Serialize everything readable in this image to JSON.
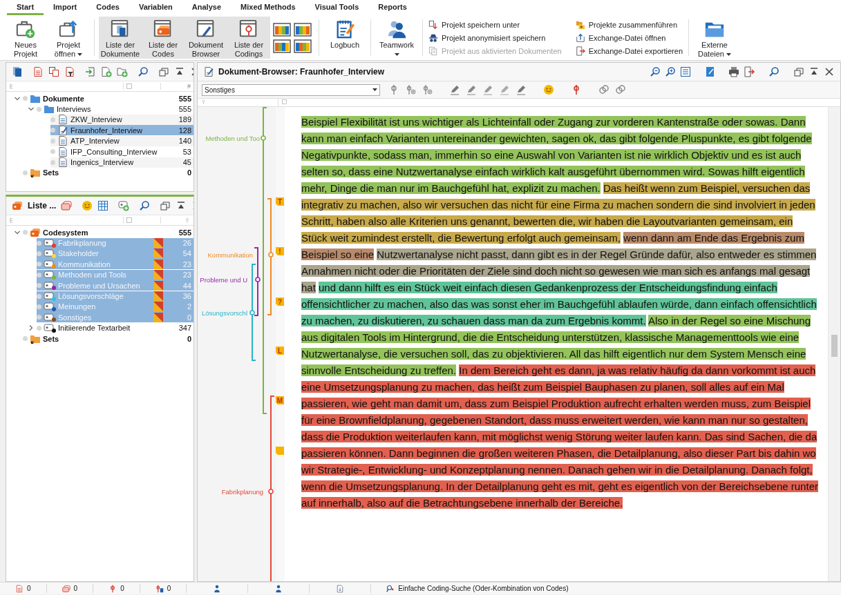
{
  "ribbon_tabs": [
    {
      "label": "Start",
      "selected": true
    },
    {
      "label": "Import",
      "selected": false
    },
    {
      "label": "Codes",
      "selected": false
    },
    {
      "label": "Variablen",
      "selected": false
    },
    {
      "label": "Analyse",
      "selected": false
    },
    {
      "label": "Mixed Methods",
      "selected": false
    },
    {
      "label": "Visual Tools",
      "selected": false
    },
    {
      "label": "Reports",
      "selected": false
    }
  ],
  "ribbon": [
    {
      "kind": "large",
      "label": "Neues Projekt",
      "dropdown": false,
      "selected": false
    },
    {
      "kind": "large",
      "label": "Projekt öffnen",
      "dropdown": true,
      "selected": false
    },
    {
      "kind": "large",
      "label": "Liste der Dokumente",
      "dropdown": false,
      "selected": true
    },
    {
      "kind": "large",
      "label": "Liste der Codes",
      "dropdown": false,
      "selected": true
    },
    {
      "kind": "large",
      "label": "Dokument Browser",
      "dropdown": false,
      "selected": true
    },
    {
      "kind": "large",
      "label": "Liste der Codings",
      "dropdown": false,
      "selected": true
    },
    {
      "kind": "layouts"
    },
    {
      "kind": "large",
      "label": "Logbuch",
      "dropdown": false,
      "selected": false
    },
    {
      "kind": "large",
      "label": "Teamwork",
      "dropdown": true,
      "selected": false
    },
    {
      "kind": "commands",
      "items": [
        {
          "label": "Projekt speichern unter",
          "disabled": false
        },
        {
          "label": "Projekt anonymisiert speichern",
          "disabled": false
        },
        {
          "label": "Projekt aus aktivierten Dokumenten",
          "disabled": true
        },
        {
          "label": "Projekte zusammenführen",
          "disabled": false
        },
        {
          "label": "Exchange-Datei öffnen",
          "disabled": false
        },
        {
          "label": "Exchange-Datei exportieren",
          "disabled": false
        }
      ]
    },
    {
      "kind": "large",
      "label": "Externe Dateien",
      "dropdown": true,
      "selected": false
    }
  ],
  "documents_panel": {
    "count_header": "#",
    "tree": [
      {
        "kind": "folder",
        "label": "Dokumente",
        "count": "555",
        "expanded": true,
        "children": [
          {
            "kind": "folder",
            "label": "Interviews",
            "count": "555",
            "expanded": true,
            "children": [
              {
                "kind": "document",
                "label": "ZKW_Interview",
                "count": "189",
                "selected": false,
                "open": false
              },
              {
                "kind": "document",
                "label": "Fraunhofer_Interview",
                "count": "128",
                "selected": true,
                "open": true
              },
              {
                "kind": "document",
                "label": "ATP_Interview",
                "count": "140",
                "selected": false,
                "open": false
              },
              {
                "kind": "document",
                "label": "IFP_Consulting_Interview",
                "count": "53",
                "selected": false,
                "open": false
              },
              {
                "kind": "document",
                "label": "Ingenics_Interview",
                "count": "45",
                "selected": false,
                "open": false
              }
            ]
          }
        ]
      },
      {
        "kind": "set",
        "label": "Sets",
        "count": "0"
      }
    ]
  },
  "codes_panel": {
    "title": "Liste ...",
    "tree": [
      {
        "kind": "codesystem",
        "label": "Codesystem",
        "count": "555",
        "expanded": true,
        "children": [
          {
            "kind": "code",
            "label": "Fabrikplanung",
            "count": "26",
            "color": "#e53935",
            "selected": true,
            "flag": true
          },
          {
            "kind": "code",
            "label": "Stakeholder",
            "count": "54",
            "color": "#fdd835",
            "selected": true,
            "flag": true
          },
          {
            "kind": "code",
            "label": "Kommunikation",
            "count": "23",
            "color": "#fb8c00",
            "selected": true,
            "flag": true
          },
          {
            "kind": "code",
            "label": "Methoden und Tools",
            "count": "23",
            "color": "#7cb342",
            "selected": true,
            "flag": true
          },
          {
            "kind": "code",
            "label": "Probleme und Ursachen",
            "count": "44",
            "color": "#8e24aa",
            "selected": true,
            "flag": true
          },
          {
            "kind": "code",
            "label": "Lösungsvorschläge",
            "count": "36",
            "color": "#26c6da",
            "selected": true,
            "flag": true
          },
          {
            "kind": "code",
            "label": "Meinungen",
            "count": "2",
            "color": "#1e5aa8",
            "selected": true,
            "flag": true
          },
          {
            "kind": "code",
            "label": "Sonstiges",
            "count": "0",
            "color": "#8d4a1a",
            "selected": true,
            "flag": true
          },
          {
            "kind": "code",
            "label": "Initiierende Textarbeit",
            "count": "347",
            "color": "#111111",
            "selected": false,
            "flag": false,
            "expanded": false
          }
        ]
      },
      {
        "kind": "set",
        "label": "Sets",
        "count": "0"
      }
    ]
  },
  "document_browser": {
    "title": "Dokument-Browser: Fraunhofer_Interview",
    "code_dropdown": "Sonstiges",
    "codings": [
      {
        "code": "Methoden und Too",
        "color": "#7cb342"
      },
      {
        "code": "Kommunikation",
        "color": "#f08a24"
      },
      {
        "code": "Probleme und U",
        "color": "#9c27b0"
      },
      {
        "code": "Lösungsvorschl",
        "color": "#26b5c9"
      },
      {
        "code": "Fabrikplanung",
        "color": "#e2493a"
      }
    ],
    "memos": [
      {
        "kind": "letter",
        "symbol": "T"
      },
      {
        "kind": "letter",
        "symbol": "!"
      },
      {
        "kind": "letter",
        "symbol": "?"
      },
      {
        "kind": "letter",
        "symbol": "L"
      },
      {
        "kind": "letter",
        "symbol": "M"
      },
      {
        "kind": "plain"
      }
    ],
    "segments": [
      {
        "color": "#93c35a",
        "text": "Beispiel Flexibilität ist uns wichtiger als Lichteinfall oder Zugang zur vorderen Kantenstraße oder sowas. Dann kann man einfach Varianten untereinander gewichten, sagen ok, das gibt folgende Pluspunkte, es gibt folgende Negativpunkte, sodass man, immerhin so eine Auswahl von Varianten ist nie wirklich Objektiv und es ist auch selten so, dass eine Nutzwertanalyse einfach wirklich kalt ausgeführt übernommen wird. Sowas hilft eigentlich mehr, Dinge die man nur im Bauchgefühl hat, explizit zu machen."
      },
      {
        "color": "#c8aa4c",
        "text": "Das heißt wenn zum Beispiel, versuchen das integrativ zu machen, also wir versuchen das nicht für eine Firma zu machen sondern die sind involviert in jeden Schritt, haben also alle Kriterien uns genannt, bewerten die, wir haben die Layoutvarianten gemeinsam, ein Stück weit zumindest erstellt, die Bewertung erfolgt auch gemeinsam,"
      },
      {
        "color": "#b98a6a",
        "text": "wenn dann am Ende das Ergebnis zum Beispiel so eine"
      },
      {
        "color": "#aaa58c",
        "text": "Nutzwertanalyse nicht passt, dann gibt es in der Regel Gründe dafür, also entweder es stimmen Annahmen nicht oder die Prioritäten der Ziele sind doch nicht so gewesen wie man sich es anfangs mal gesagt hat"
      },
      {
        "color": "#60c498",
        "text": "und dann hilft es ein Stück weit einfach diesen Gedankenprozess der Entscheidungsfindung einfach offensichtlicher zu machen, also das was sonst eher im Bauchgefühl ablaufen würde, dann einfach offensichtlich zu machen, zu diskutieren, zu schauen dass man da zum Ergebnis kommt."
      },
      {
        "color": "#93c35a",
        "text": "Also in der Regel so eine Mischung aus digitalen Tools im Hintergrund, die die Entscheidung unterstützen, klassische Managementtools wie eine Nutzwertanalyse, die versuchen soll, das zu objektivieren. All das hilft eigentlich nur dem System Mensch eine sinnvolle Entscheidung zu treffen."
      },
      {
        "color": "#e2604f",
        "text": "In dem Bereich geht es dann, ja was relativ häufig da dann vorkommt ist auch eine Umsetzungsplanung zu machen, das heißt zum Beispiel Bauphasen zu planen, soll alles auf ein Mal passieren, wie geht man damit um, dass zum Beispiel Produktion aufrecht erhalten werden muss, zum Beispiel für eine Brownfieldplanung, gegebenen Standort, dass muss erweitert werden, wie kann man nur so gestalten, dass die Produktion weiterlaufen kann, mit möglichst wenig Störung weiter laufen kann. Das sind Sachen, die da passieren können. Dann beginnen die großen weiteren Phasen, die Detailplanung, also dieser Part bis dahin wo wir Strategie-, Entwicklung- und Konzeptplanung nennen. Danach gehen wir in die Detailplanung. Danach folgt, wenn die Umsetzungsplanung. In der Detailplanung geht es mit, geht es eigentlich von der Bereichsebene runter auf innerhalb, also auf die Betrachtungsebene innerhalb der Bereiche."
      }
    ]
  },
  "status_bar": {
    "counts": [
      {
        "count": "0"
      },
      {
        "count": "0"
      },
      {
        "count": "0"
      },
      {
        "count": "0"
      }
    ],
    "search_mode": "Einfache Coding-Suche (Oder-Kombination von Codes)"
  }
}
